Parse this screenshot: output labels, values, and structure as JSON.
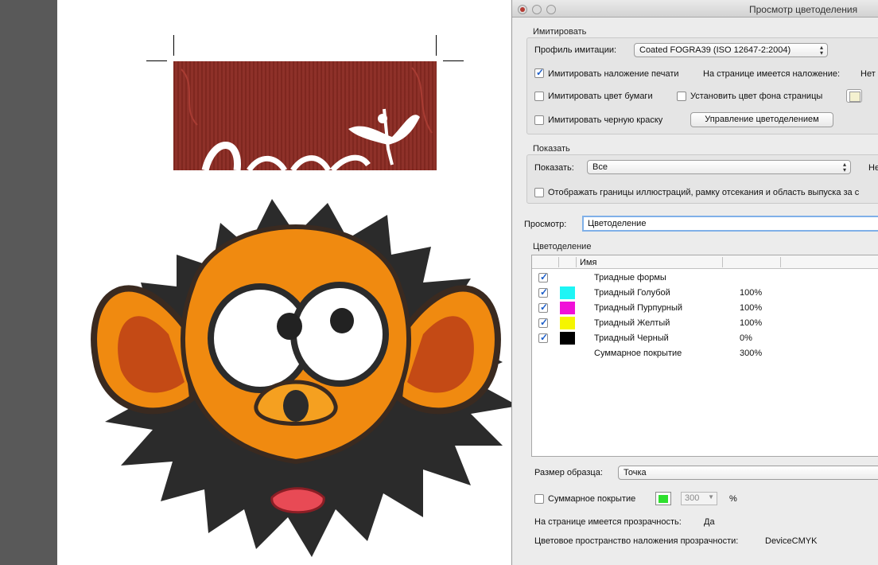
{
  "window": {
    "title": "Просмотр цветоделения"
  },
  "simulate": {
    "group_title": "Имитировать",
    "profile_label": "Профиль имитации:",
    "profile_value": "Coated FOGRA39 (ISO 12647-2:2004)",
    "overprint_label": "Имитировать наложение печати",
    "overprint_checked": true,
    "page_has_overprint_label": "На странице имеется наложение:",
    "page_has_overprint_value": "Нет",
    "paper_color_label": "Имитировать цвет бумаги",
    "page_bg_label": "Установить цвет фона страницы",
    "black_ink_label": "Имитировать черную краску",
    "ink_manager_button": "Управление цветоделением"
  },
  "show": {
    "group_title": "Показать",
    "show_label": "Показать:",
    "show_value": "Все",
    "right_cut": "Не",
    "art_box_label": "Отображать границы иллюстраций, рамку отсекания и область выпуска за с"
  },
  "preview": {
    "label": "Просмотр:",
    "value": "Цветоделение"
  },
  "separations": {
    "group_title": "Цветоделение",
    "column_name": "Имя",
    "rows": [
      {
        "checked": true,
        "color": "",
        "name": "Триадные формы",
        "percent": ""
      },
      {
        "checked": true,
        "color": "#1ef5f5",
        "name": "Триадный Голубой",
        "percent": "100%"
      },
      {
        "checked": true,
        "color": "#f010d8",
        "name": "Триадный Пурпурный",
        "percent": "100%"
      },
      {
        "checked": true,
        "color": "#f5f500",
        "name": "Триадный Желтый",
        "percent": "100%"
      },
      {
        "checked": true,
        "color": "#000000",
        "name": "Триадный Черный",
        "percent": "0%"
      },
      {
        "checked": false,
        "color": "",
        "name": "Суммарное покрытие",
        "percent": "300%"
      }
    ]
  },
  "sample": {
    "label": "Размер образца:",
    "value": "Точка"
  },
  "total_coverage": {
    "label": "Суммарное покрытие",
    "value": "300",
    "unit": "%"
  },
  "transparency": {
    "has_label": "На странице имеется прозрачность:",
    "has_value": "Да",
    "space_label": "Цветовое пространство наложения прозрачности:",
    "space_value": "DeviceCMYK"
  }
}
